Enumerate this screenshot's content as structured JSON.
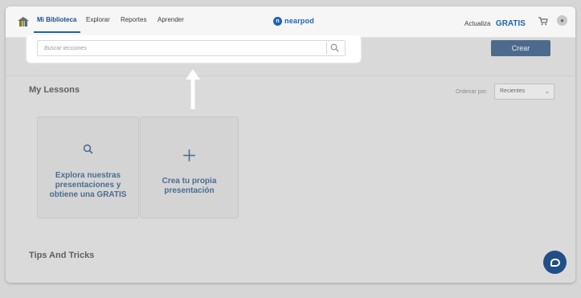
{
  "nav": {
    "items": [
      {
        "label": "Mi Biblioteca"
      },
      {
        "label": "Explorar"
      },
      {
        "label": "Reportes"
      },
      {
        "label": "Aprender"
      }
    ]
  },
  "brand": {
    "name": "nearpod"
  },
  "upgrade": {
    "label": "Actualiza",
    "badge": "GRATIS"
  },
  "toolbar": {
    "create_label": "Crear"
  },
  "search": {
    "placeholder": "Buscar lecciones",
    "value": ""
  },
  "lessons": {
    "title": "My Lessons",
    "order_label": "Ordenar por:",
    "order_value": "Recientes"
  },
  "cards": [
    {
      "text": "Explora nuestras presentaciones y obtiene una GRATIS",
      "icon": "search-icon"
    },
    {
      "text": "Crea tu propia presentación",
      "icon": "plus-icon"
    }
  ],
  "tips": {
    "title": "Tips And Tricks"
  },
  "colors": {
    "accent": "#1e63b5",
    "card_text": "#4a6d93",
    "create_button": "#4d6a8c",
    "chat": "#1f4f86",
    "overlay": "#dadada"
  }
}
